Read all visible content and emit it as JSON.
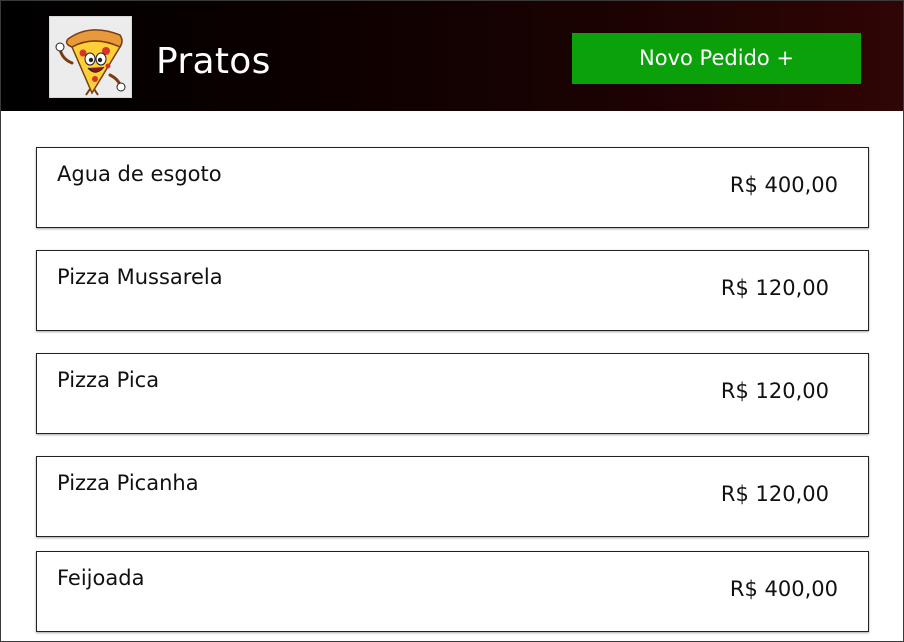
{
  "header": {
    "logo_icon": "pizza-mascot-icon",
    "title": "Pratos",
    "new_order_label": "Novo Pedido +",
    "accent_color": "#0aa10a"
  },
  "dishes": [
    {
      "name": "Agua de esgoto",
      "price": "R$ 400,00"
    },
    {
      "name": "Pizza Mussarela",
      "price": "R$ 120,00"
    },
    {
      "name": "Pizza Pica",
      "price": "R$ 120,00"
    },
    {
      "name": "Pizza Picanha",
      "price": "R$ 120,00"
    },
    {
      "name": "Feijoada",
      "price": "R$ 400,00"
    }
  ]
}
